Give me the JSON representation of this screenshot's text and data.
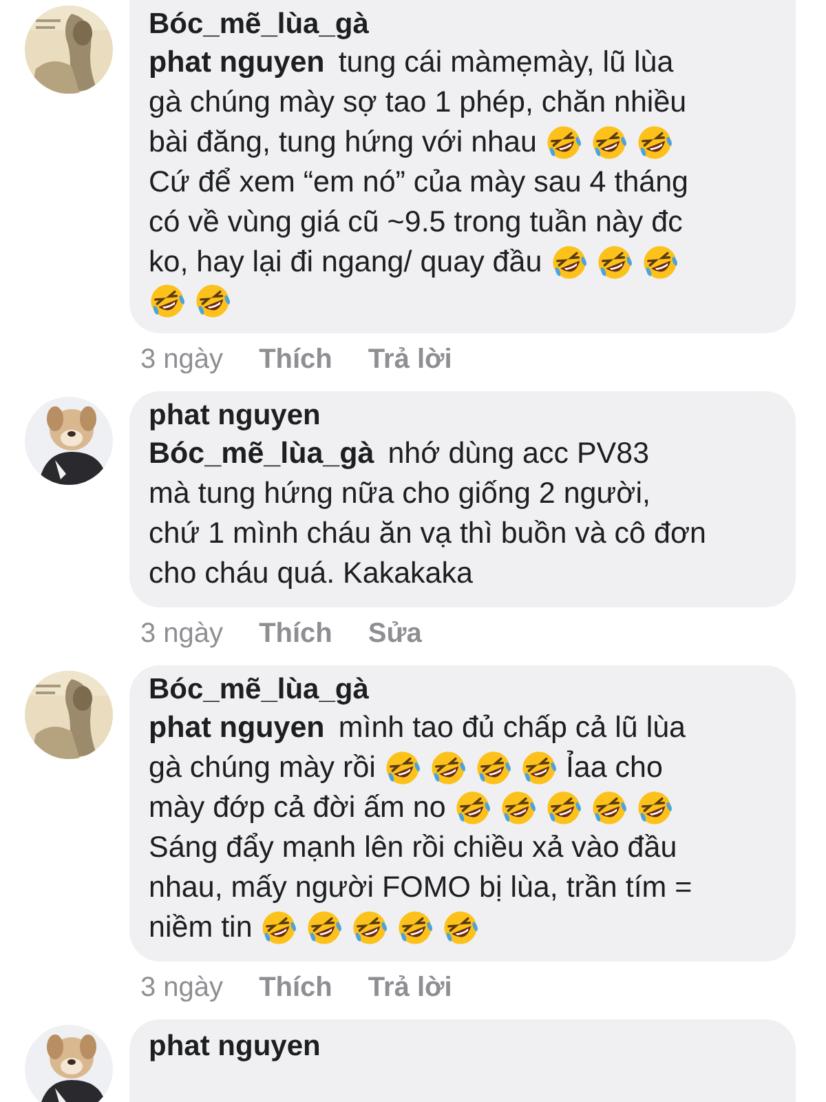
{
  "comments": [
    {
      "author": "Bóc_mẽ_lùa_gà",
      "lines": [
        [
          {
            "kind": "mention",
            "text": "phat nguyen"
          },
          {
            "kind": "text",
            "text": "tung cái màmẹmày, lũ lùa"
          }
        ],
        [
          {
            "kind": "text",
            "text": "gà chúng mày sợ tao 1 phép, chăn nhiều"
          }
        ],
        [
          {
            "kind": "text",
            "text": "bài đăng, tung hứng với nhau"
          },
          {
            "kind": "emoji"
          },
          {
            "kind": "emoji"
          },
          {
            "kind": "emoji"
          }
        ],
        [
          {
            "kind": "text",
            "text": "Cứ để xem “em nó” của mày sau 4 tháng"
          }
        ],
        [
          {
            "kind": "text",
            "text": "có về vùng giá cũ ~9.5 trong tuần này đc"
          }
        ],
        [
          {
            "kind": "text",
            "text": "ko, hay lại đi ngang/ quay đầu"
          },
          {
            "kind": "emoji"
          },
          {
            "kind": "emoji"
          },
          {
            "kind": "emoji"
          }
        ],
        [
          {
            "kind": "emoji"
          },
          {
            "kind": "emoji"
          }
        ]
      ],
      "actions": [
        {
          "kind": "time",
          "text": "3 ngày"
        },
        {
          "kind": "action",
          "text": "Thích"
        },
        {
          "kind": "action",
          "text": "Trả lời"
        }
      ]
    },
    {
      "author": "phat nguyen",
      "lines": [
        [
          {
            "kind": "mention",
            "text": "Bóc_mẽ_lùa_gà"
          },
          {
            "kind": "text",
            "text": "nhớ dùng acc PV83"
          }
        ],
        [
          {
            "kind": "text",
            "text": "mà tung hứng nữa cho giống 2 người,"
          }
        ],
        [
          {
            "kind": "text",
            "text": "chứ 1 mình cháu ăn vạ thì buồn và cô đơn"
          }
        ],
        [
          {
            "kind": "text",
            "text": "cho cháu quá. Kakakaka"
          }
        ]
      ],
      "actions": [
        {
          "kind": "time",
          "text": "3 ngày"
        },
        {
          "kind": "action",
          "text": "Thích"
        },
        {
          "kind": "action",
          "text": "Sửa"
        }
      ]
    },
    {
      "author": "Bóc_mẽ_lùa_gà",
      "lines": [
        [
          {
            "kind": "mention",
            "text": "phat nguyen"
          },
          {
            "kind": "text",
            "text": "mình tao đủ chấp cả lũ lùa"
          }
        ],
        [
          {
            "kind": "text",
            "text": "gà chúng mày rồi"
          },
          {
            "kind": "emoji"
          },
          {
            "kind": "emoji"
          },
          {
            "kind": "emoji"
          },
          {
            "kind": "emoji"
          },
          {
            "kind": "text",
            "text": "Ỉaa cho"
          }
        ],
        [
          {
            "kind": "text",
            "text": "mày đớp cả đời ấm no"
          },
          {
            "kind": "emoji"
          },
          {
            "kind": "emoji"
          },
          {
            "kind": "emoji"
          },
          {
            "kind": "emoji"
          },
          {
            "kind": "emoji"
          }
        ],
        [
          {
            "kind": "text",
            "text": "Sáng đẩy mạnh lên rồi chiều xả vào đầu"
          }
        ],
        [
          {
            "kind": "text",
            "text": "nhau, mấy người FOMO bị lùa, trần tím ="
          }
        ],
        [
          {
            "kind": "text",
            "text": "niềm tin"
          },
          {
            "kind": "emoji"
          },
          {
            "kind": "emoji"
          },
          {
            "kind": "emoji"
          },
          {
            "kind": "emoji"
          },
          {
            "kind": "emoji"
          }
        ]
      ],
      "actions": [
        {
          "kind": "time",
          "text": "3 ngày"
        },
        {
          "kind": "action",
          "text": "Thích"
        },
        {
          "kind": "action",
          "text": "Trả lời"
        }
      ]
    },
    {
      "author": "phat nguyen"
    }
  ]
}
